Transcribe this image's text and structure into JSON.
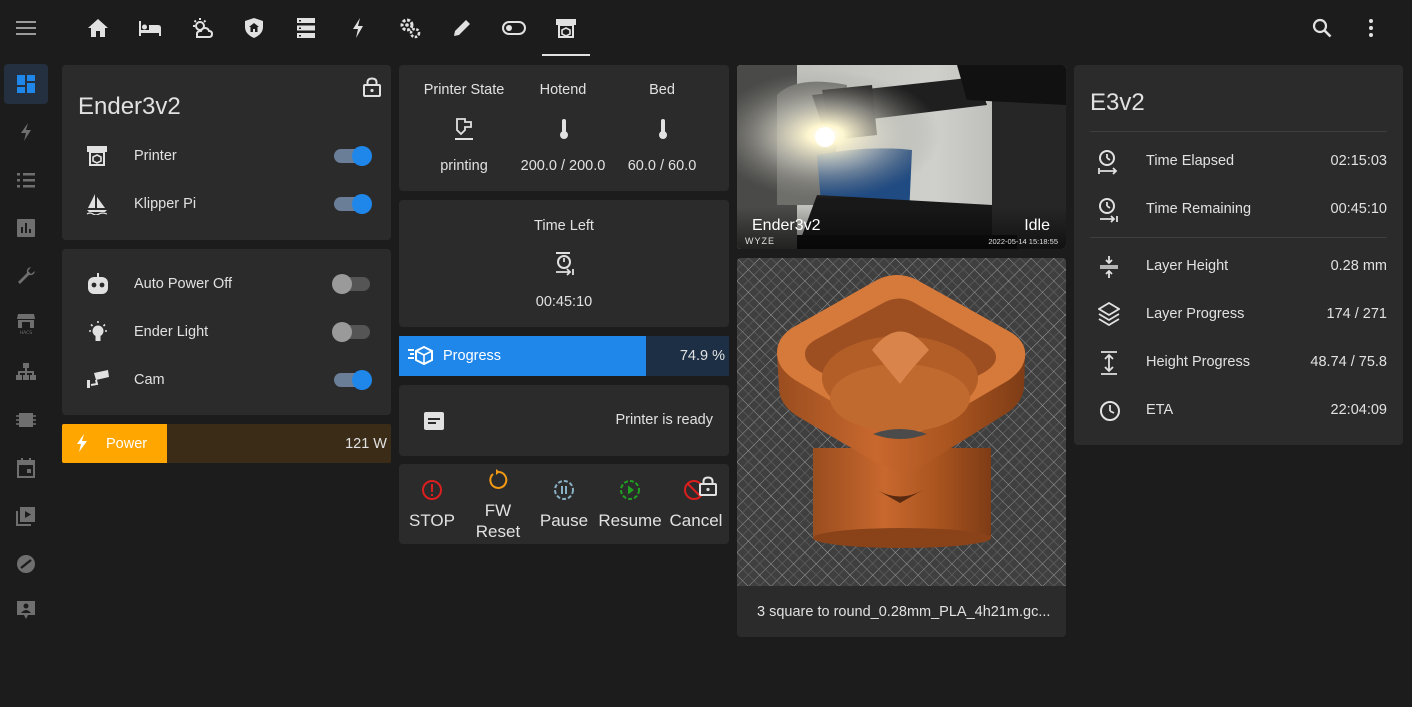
{
  "tabs": [
    {
      "name": "home-icon"
    },
    {
      "name": "bed-icon"
    },
    {
      "name": "weather-icon"
    },
    {
      "name": "shield-home-icon"
    },
    {
      "name": "server-icon"
    },
    {
      "name": "lightning-icon"
    },
    {
      "name": "cogs-icon"
    },
    {
      "name": "pen-icon"
    },
    {
      "name": "toggle-icon"
    },
    {
      "name": "printer-3d-icon",
      "active": true
    }
  ],
  "sidebar": [
    {
      "name": "dashboard-icon",
      "active": true
    },
    {
      "name": "energy-icon"
    },
    {
      "name": "list-icon"
    },
    {
      "name": "chart-icon"
    },
    {
      "name": "wrench-icon"
    },
    {
      "name": "hacs-icon"
    },
    {
      "name": "network-icon"
    },
    {
      "name": "chip-icon"
    },
    {
      "name": "calendar-icon"
    },
    {
      "name": "media-icon"
    },
    {
      "name": "zwave-icon"
    },
    {
      "name": "user-icon"
    }
  ],
  "power_card": {
    "title": "Ender3v2",
    "items": [
      {
        "label": "Printer",
        "state": "on"
      },
      {
        "label": "Klipper Pi",
        "state": "on"
      }
    ]
  },
  "switches_card": {
    "items": [
      {
        "label": "Auto Power Off",
        "state": "off"
      },
      {
        "label": "Ender Light",
        "state": "off"
      },
      {
        "label": "Cam",
        "state": "on"
      }
    ]
  },
  "power_bar": {
    "label": "Power",
    "value": "121 W",
    "fraction": 0.32,
    "color": "#ffa600"
  },
  "status_card": {
    "cols": [
      {
        "header": "Printer State",
        "value": "printing"
      },
      {
        "header": "Hotend",
        "value": "200.0 / 200.0"
      },
      {
        "header": "Bed",
        "value": "60.0 / 60.0"
      }
    ]
  },
  "time_left": {
    "header": "Time Left",
    "value": "00:45:10"
  },
  "progress": {
    "label": "Progress",
    "value": "74.9 %",
    "fraction": 0.749,
    "color": "#1f87ea"
  },
  "message": {
    "text": "Printer is ready"
  },
  "actions": [
    {
      "label": "STOP",
      "color": "#db1e1e"
    },
    {
      "label": "FW\nReset",
      "color": "#f29a14"
    },
    {
      "label": "Pause",
      "color": "#8ab0c4"
    },
    {
      "label": "Resume",
      "color": "#21a121"
    },
    {
      "label": "Cancel",
      "color": "#db1e1e"
    }
  ],
  "camera": {
    "name": "Ender3v2",
    "state": "Idle",
    "watermark": "WYZE",
    "timestamp": "2022-05-14 15:18:55"
  },
  "preview": {
    "filename": "3 square to round_0.28mm_PLA_4h21m.gc..."
  },
  "stats_card": {
    "title": "E3v2",
    "group1": [
      {
        "label": "Time Elapsed",
        "value": "02:15:03"
      },
      {
        "label": "Time Remaining",
        "value": "00:45:10"
      }
    ],
    "group2": [
      {
        "label": "Layer Height",
        "value": "0.28 mm"
      },
      {
        "label": "Layer Progress",
        "value": "174 / 271"
      },
      {
        "label": "Height Progress",
        "value": "48.74 / 75.8"
      },
      {
        "label": "ETA",
        "value": "22:04:09"
      }
    ]
  }
}
